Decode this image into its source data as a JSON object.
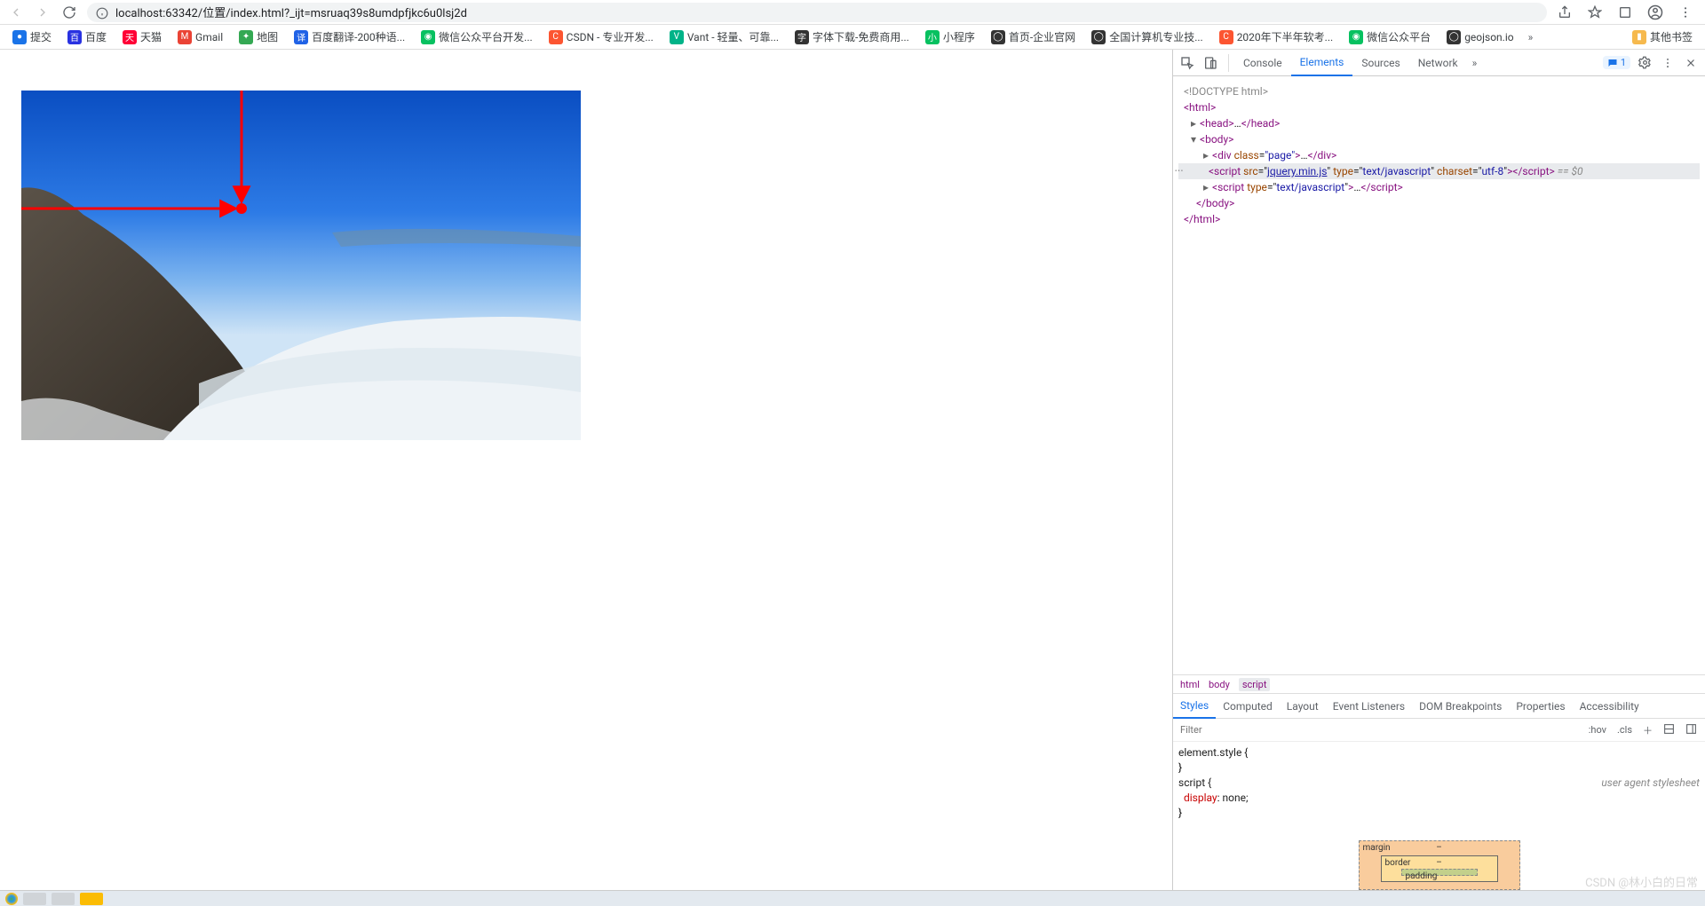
{
  "browser": {
    "url": "localhost:63342/位置/index.html?_ijt=msruaq39s8umdpfjkc6u0lsj2d"
  },
  "bookmarks": [
    {
      "label": "提交",
      "color": "#1a73e8"
    },
    {
      "label": "百度",
      "color": "#2932e1"
    },
    {
      "label": "天猫",
      "color": "#ff0036"
    },
    {
      "label": "Gmail",
      "color": "#ea4335"
    },
    {
      "label": "地图",
      "color": "#34a853"
    },
    {
      "label": "百度翻译-200种语...",
      "color": "#2062e6"
    },
    {
      "label": "微信公众平台开发...",
      "color": "#07c160"
    },
    {
      "label": "CSDN - 专业开发...",
      "color": "#fc5531"
    },
    {
      "label": "Vant - 轻量、可靠...",
      "color": "#00b388"
    },
    {
      "label": "字体下载-免费商用...",
      "color": "#333"
    },
    {
      "label": "小程序",
      "color": "#07c160"
    },
    {
      "label": "首页-企业官网",
      "color": "#333"
    },
    {
      "label": "全国计算机专业技...",
      "color": "#333"
    },
    {
      "label": "2020年下半年软考...",
      "color": "#fc5531"
    },
    {
      "label": "微信公众平台",
      "color": "#07c160"
    },
    {
      "label": "geojson.io",
      "color": "#333"
    },
    {
      "label_other": "其他书签"
    }
  ],
  "bookmarks_other": "其他书签",
  "devtools": {
    "tabs": [
      "Console",
      "Elements",
      "Sources",
      "Network"
    ],
    "active_tab": "Elements",
    "issues_count": "1",
    "dom": {
      "l0": "<!DOCTYPE html>",
      "l1_open": "<html>",
      "l2_head": "<head>…</head>",
      "l3_body_open": "<body>",
      "l4_div": "<div class=\"page\">…</div>",
      "l5_script_prefix": "<script src=\"",
      "l5_script_link": "jquery.min.js",
      "l5_script_mid": "\" type=\"",
      "l5_script_type": "text/javascript",
      "l5_script_mid2": "\" charset=\"",
      "l5_script_charset": "utf-8",
      "l5_script_suffix": "\"></script>",
      "l5_eq0": " == $0",
      "l6_script2": "<script type=\"text/javascript\">…</script>",
      "l7_body_close": "</body>",
      "l8_html_close": "</html>"
    },
    "crumbs": [
      "html",
      "body",
      "script"
    ],
    "styles_tabs": [
      "Styles",
      "Computed",
      "Layout",
      "Event Listeners",
      "DOM Breakpoints",
      "Properties",
      "Accessibility"
    ],
    "styles_active": "Styles",
    "filter_placeholder": "Filter",
    "filter_right": [
      ":hov",
      ".cls"
    ],
    "rules": {
      "r1_sel": "element.style {",
      "r1_close": "}",
      "r2_sel": "script {",
      "r2_origin": "user agent stylesheet",
      "r2_prop": "display",
      "r2_val": "none;",
      "r2_close": "}"
    },
    "box": {
      "margin": "margin",
      "border": "border",
      "padding": "padding",
      "dash": "–"
    }
  },
  "watermark": "CSDN @林小白的日常"
}
